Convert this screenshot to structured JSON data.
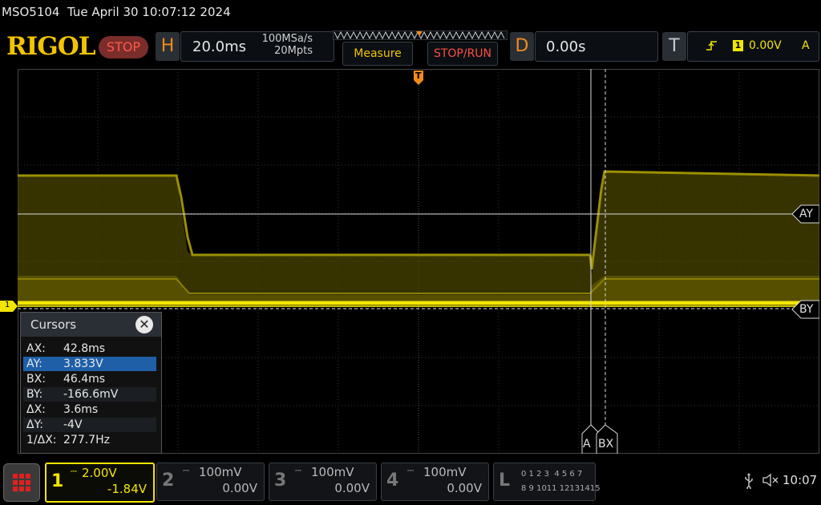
{
  "status_line": {
    "model": "MSO5104",
    "datetime": "Tue April 30 10:07:12 2024"
  },
  "header": {
    "logo": "RIGOL",
    "run_state": "STOP",
    "horizontal": {
      "letter": "H",
      "timebase": "20.0ms",
      "sample_rate": "100MSa/s",
      "memory_depth": "20Mpts"
    },
    "measure_label": "Measure",
    "stop_run_label": "STOP/RUN",
    "delay": {
      "letter": "D",
      "value": "0.00s"
    },
    "trigger": {
      "letter": "T",
      "source": "1",
      "level": "0.00V",
      "mode": "A"
    }
  },
  "screen": {
    "channel_marker": "1",
    "trigger_marker": "T",
    "cursor_labels": {
      "ay": "AY",
      "by": "BY",
      "ax": "A",
      "bx": "BX"
    }
  },
  "cursors": {
    "title": "Cursors",
    "rows": [
      {
        "key": "AX:",
        "value": "42.8ms"
      },
      {
        "key": "AY:",
        "value": "3.833V"
      },
      {
        "key": "BX:",
        "value": "46.4ms"
      },
      {
        "key": "BY:",
        "value": "-166.6mV"
      },
      {
        "key": "ΔX:",
        "value": "3.6ms"
      },
      {
        "key": "ΔY:",
        "value": "-4V"
      },
      {
        "key": "1/ΔX:",
        "value": "277.7Hz"
      }
    ]
  },
  "channels": [
    {
      "num": "1",
      "scale": "2.00V",
      "offset": "-1.84V",
      "color": "#f2e600"
    },
    {
      "num": "2",
      "scale": "100mV",
      "offset": "0.00V",
      "color": "#777777"
    },
    {
      "num": "3",
      "scale": "100mV",
      "offset": "0.00V",
      "color": "#777777"
    },
    {
      "num": "4",
      "scale": "100mV",
      "offset": "0.00V",
      "color": "#777777"
    }
  ],
  "logic": {
    "letter": "L",
    "row1": "0 1 2 3  4 5 6 7",
    "row2": "8 9 1011 12131415"
  },
  "system": {
    "clock": "10:07"
  },
  "colors": {
    "ch1": "#f2e600",
    "accent": "#f08a1c",
    "stop": "#ff5a4a"
  }
}
